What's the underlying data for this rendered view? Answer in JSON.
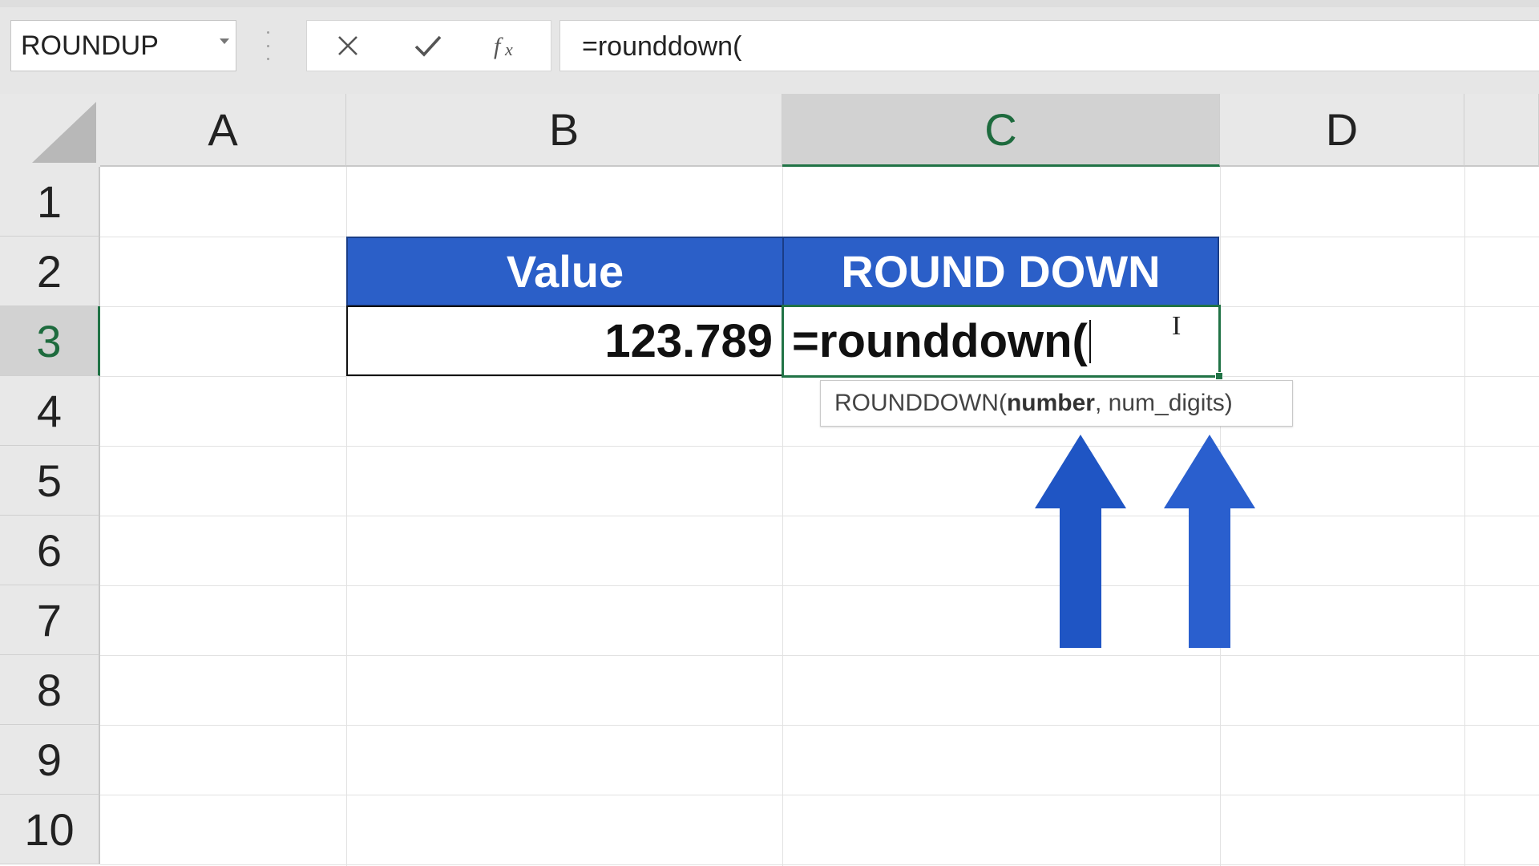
{
  "formula_bar": {
    "name_box": "ROUNDUP",
    "formula": "=rounddown("
  },
  "columns": [
    "A",
    "B",
    "C",
    "D"
  ],
  "rows": [
    "1",
    "2",
    "3",
    "4",
    "5",
    "6",
    "7",
    "8",
    "9",
    "10"
  ],
  "selected_column": "C",
  "selected_row": "3",
  "table": {
    "header_value": "Value",
    "header_round_down": "ROUND DOWN",
    "value": "123.789",
    "editing_text": "=rounddown("
  },
  "tooltip": {
    "function_name": "ROUNDDOWN(",
    "arg1": "number",
    "rest": ", num_digits)"
  },
  "colors": {
    "header_fill": "#2b5fc8",
    "selection_green": "#217346",
    "arrow_blue": "#1f55c4"
  },
  "icons": [
    "cancel-icon",
    "enter-icon",
    "fx-icon",
    "dropdown-arrow-icon",
    "ibeam-cursor-icon",
    "up-arrow-icon"
  ]
}
